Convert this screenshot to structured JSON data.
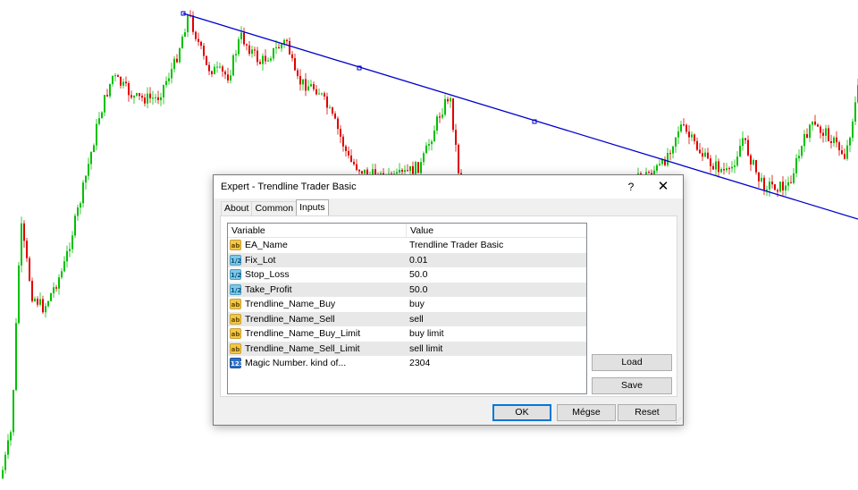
{
  "chart": {
    "trendline_color": "#0000cc",
    "bull_color": "#00c000",
    "bear_color": "#e00000"
  },
  "dialog": {
    "title": "Expert - Trendline Trader Basic",
    "help_label": "?",
    "close_label": "✕",
    "tabs": [
      {
        "label": "About"
      },
      {
        "label": "Common"
      },
      {
        "label": "Inputs"
      }
    ],
    "active_tab": "Inputs",
    "grid": {
      "headers": {
        "variable": "Variable",
        "value": "Value"
      },
      "rows": [
        {
          "icon": "ab",
          "variable": "EA_Name",
          "value": "Trendline Trader Basic"
        },
        {
          "icon": "1/2",
          "variable": "Fix_Lot",
          "value": "0.01"
        },
        {
          "icon": "1/2",
          "variable": "Stop_Loss",
          "value": "50.0"
        },
        {
          "icon": "1/2",
          "variable": "Take_Profit",
          "value": "50.0"
        },
        {
          "icon": "ab",
          "variable": "Trendline_Name_Buy",
          "value": "buy"
        },
        {
          "icon": "ab",
          "variable": "Trendline_Name_Sell",
          "value": "sell"
        },
        {
          "icon": "ab",
          "variable": "Trendline_Name_Buy_Limit",
          "value": "buy limit"
        },
        {
          "icon": "ab",
          "variable": "Trendline_Name_Sell_Limit",
          "value": "sell limit"
        },
        {
          "icon": "123",
          "variable": "Magic Number. kind of...",
          "value": "2304"
        }
      ]
    },
    "buttons": {
      "load": "Load",
      "save": "Save",
      "ok": "OK",
      "cancel": "Mégse",
      "reset": "Reset"
    }
  }
}
